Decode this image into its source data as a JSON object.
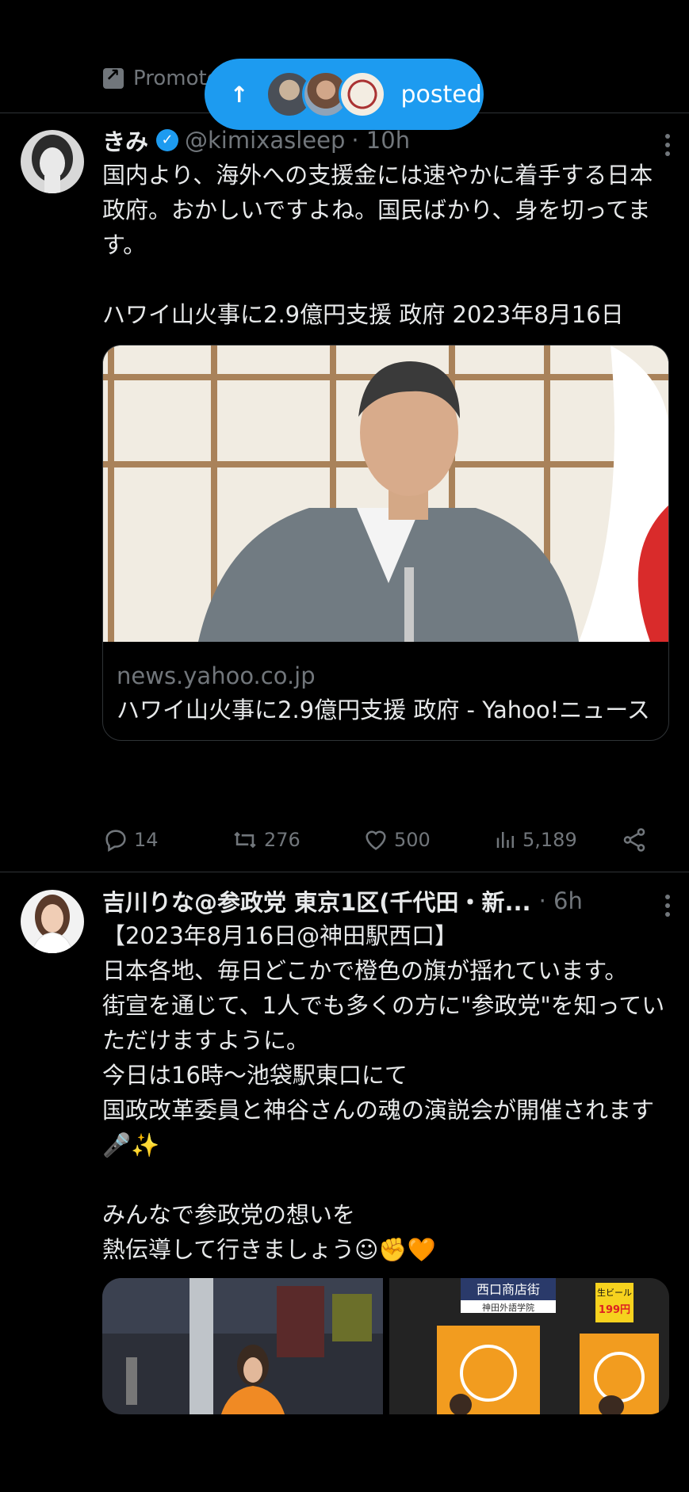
{
  "banner": {
    "promoted_label": "Promoted",
    "posted_label": "posted"
  },
  "tweets": [
    {
      "name": "きみ",
      "verified": true,
      "handle": "@kimixasleep",
      "time": "· 10h",
      "text": "国内より、海外への支援金には速やかに着手する日本政府。おかしいですよね。国民ばかり、身を切ってます。\n\nハワイ山火事に2.9億円支援 政府 2023年8月16日",
      "card": {
        "domain": "news.yahoo.co.jp",
        "title": "ハワイ山火事に2.9億円支援 政府 - Yahoo!ニュース"
      },
      "stats": {
        "replies": "14",
        "reposts": "276",
        "likes": "500",
        "views": "5,189"
      }
    },
    {
      "name": "吉川りな@参政党 東京1区(千代田・新...",
      "handle": "",
      "time": "· 6h",
      "text": "【2023年8月16日@神田駅西口】\n日本各地、毎日どこかで橙色の旗が揺れています。\n街宣を通じて、1人でも多くの方に\"参政党\"を知っていただけますように。\n今日は16時〜池袋駅東口にて\n国政改革委員と神谷さんの魂の演説会が開催されます🎤✨\n\nみんなで参政党の想いを\n熱伝導して行きましょう☺✊🧡",
      "media_signs": {
        "shop": "西口商店街",
        "school": "神田外語学院",
        "beer": "生ビール",
        "price": "199円"
      }
    }
  ],
  "colors": {
    "accent": "#1d9bf0",
    "muted": "#71767b",
    "text": "#e7e9ea",
    "divider": "#2f3336",
    "background": "#000000"
  }
}
